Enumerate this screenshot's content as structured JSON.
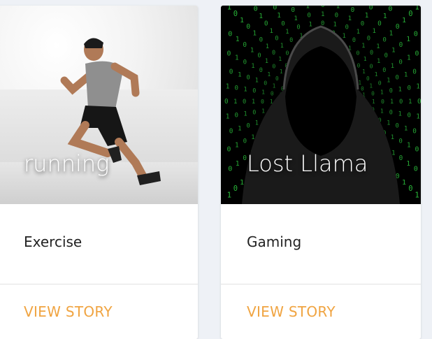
{
  "cards": [
    {
      "image_title": "running",
      "category": "Exercise",
      "action": "VIEW STORY"
    },
    {
      "image_title": "Lost Llama",
      "category": "Gaming",
      "action": "VIEW STORY"
    }
  ],
  "colors": {
    "page_background": "#eef1f6",
    "card_background": "#ffffff",
    "action_text": "#f0a441",
    "code_green": "#2ecc40"
  }
}
